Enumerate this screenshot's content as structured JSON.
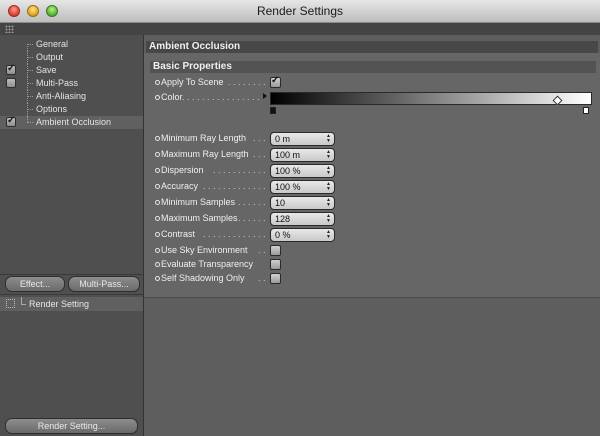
{
  "window": {
    "title": "Render Settings"
  },
  "tree": [
    {
      "label": "General",
      "checkbox": false,
      "checked": false,
      "selected": false
    },
    {
      "label": "Output",
      "checkbox": false,
      "checked": false,
      "selected": false
    },
    {
      "label": "Save",
      "checkbox": true,
      "checked": true,
      "selected": false
    },
    {
      "label": "Multi-Pass",
      "checkbox": true,
      "checked": false,
      "selected": false
    },
    {
      "label": "Anti-Aliasing",
      "checkbox": false,
      "checked": false,
      "selected": false
    },
    {
      "label": "Options",
      "checkbox": false,
      "checked": false,
      "selected": false
    },
    {
      "label": "Ambient Occlusion",
      "checkbox": true,
      "checked": true,
      "selected": true
    }
  ],
  "buttons": {
    "effect": "Effect...",
    "multipass": "Multi-Pass...",
    "render_setting": "Render Setting..."
  },
  "render_setting_item": "Render Setting",
  "panel": {
    "title": "Ambient Occlusion",
    "group": "Basic Properties",
    "apply_to_scene": {
      "label": "Apply To Scene",
      "checked": true
    },
    "color": {
      "label": "Color"
    },
    "fields": [
      {
        "label": "Minimum Ray Length",
        "value": "0 m"
      },
      {
        "label": "Maximum Ray Length",
        "value": "100 m"
      },
      {
        "label": "Dispersion",
        "value": "100 %"
      },
      {
        "label": "Accuracy",
        "value": "100 %"
      },
      {
        "label": "Minimum Samples",
        "value": "10"
      },
      {
        "label": "Maximum Samples",
        "value": "128"
      },
      {
        "label": "Contrast",
        "value": "0 %"
      }
    ],
    "checkboxes": [
      {
        "label": "Use Sky Environment",
        "checked": false
      },
      {
        "label": "Evaluate Transparency",
        "checked": false
      },
      {
        "label": "Self Shadowing Only",
        "checked": false
      }
    ]
  }
}
